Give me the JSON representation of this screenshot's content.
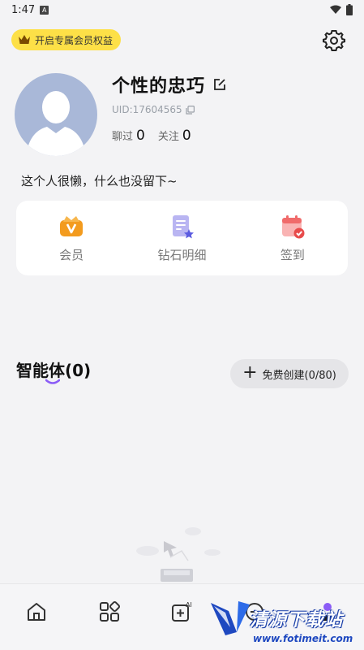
{
  "status_bar": {
    "time": "1:47",
    "notification_badge": "A"
  },
  "header": {
    "vip_label": "开启专属会员权益"
  },
  "profile": {
    "nickname": "个性的忠巧",
    "uid": "UID:17604565",
    "chat_label": "聊过",
    "chat_count": "0",
    "follow_label": "关注",
    "follow_count": "0",
    "bio": "这个人很懒，什么也没留下~"
  },
  "quick_actions": [
    {
      "label": "会员",
      "icon": "vip-crown-icon",
      "color": "#f39b1e"
    },
    {
      "label": "钻石明细",
      "icon": "diamond-detail-icon",
      "color": "#8b86e8"
    },
    {
      "label": "签到",
      "icon": "checkin-calendar-icon",
      "color": "#f06a6a"
    }
  ],
  "agents": {
    "title": "智能体(0)",
    "create_label": "免费创建(0/80)",
    "accent": "#8b5cf6"
  },
  "tab_bar": {
    "items": [
      {
        "icon": "home-icon"
      },
      {
        "icon": "discover-grid-icon"
      },
      {
        "icon": "ai-create-icon"
      },
      {
        "icon": "message-icon"
      },
      {
        "icon": "profile-icon",
        "active": true
      }
    ]
  },
  "watermark": {
    "text": "清源下载站",
    "url": "www.fotimeit.com"
  }
}
